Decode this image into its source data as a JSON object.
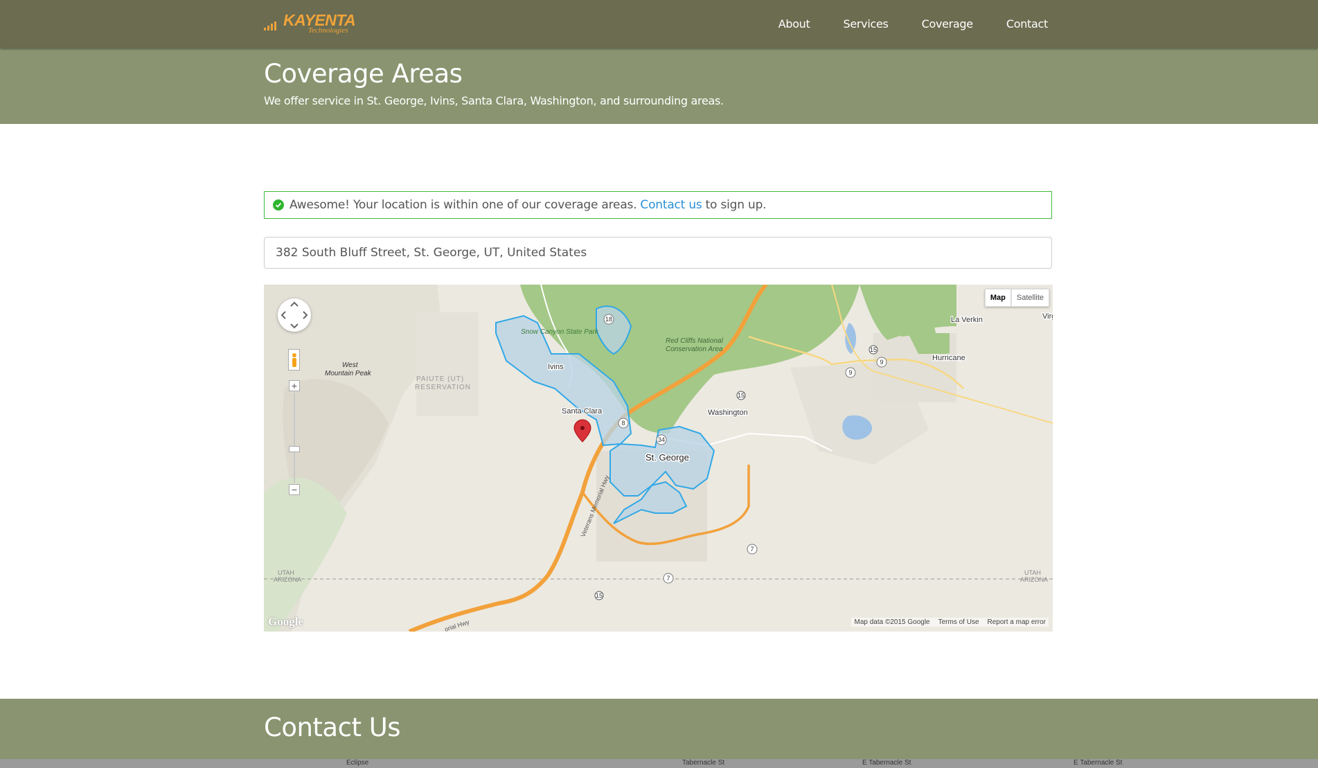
{
  "brand": {
    "name": "KAYENTA",
    "tagline": "Technologies"
  },
  "nav": {
    "items": [
      "About",
      "Services",
      "Coverage",
      "Contact"
    ]
  },
  "hero": {
    "title": "Coverage Areas",
    "subtitle": "We offer service in St. George, Ivins, Santa Clara, Washington, and surrounding areas."
  },
  "alert": {
    "pre": "Awesome! Your location is within one of our coverage areas.",
    "link": "Contact us",
    "post": "to sign up."
  },
  "search": {
    "value": "382 South Bluff Street, St. George, UT, United States"
  },
  "map": {
    "type_controls": {
      "map": "Map",
      "satellite": "Satellite",
      "selected": "Map"
    },
    "logo": "Google",
    "attribution": {
      "data": "Map data ©2015 Google",
      "terms": "Terms of Use",
      "report": "Report a map error"
    },
    "labels": {
      "st_george": "St. George",
      "ivins": "Ivins",
      "santa_clara": "Santa Clara",
      "washington": "Washington",
      "hurricane": "Hurricane",
      "la_verkin": "La Verkin",
      "virgin": "Virg",
      "snow_canyon": "Snow Canyon State Park",
      "red_cliffs_1": "Red Cliffs National",
      "red_cliffs_2": "Conservation Area",
      "west_mountain_1": "West",
      "west_mountain_2": "Mountain Peak",
      "paiute_1": "PAIUTE (UT)",
      "paiute_2": "RESERVATION",
      "utah_left": "UTAH",
      "arizona_left": "ARIZONA",
      "utah_right": "UTAH",
      "arizona_right": "ARIZONA",
      "veterans_hwy": "Veterans Memorial Hwy",
      "memorial_hwy": "orial Hwy"
    },
    "shields": [
      "15",
      "15",
      "15",
      "18",
      "8",
      "34",
      "9",
      "9",
      "7",
      "7"
    ],
    "colors": {
      "coverage_fill": "#b9d3e4",
      "coverage_stroke": "#31a8e6",
      "highway": "#f2a13b",
      "park": "#a4c887"
    }
  },
  "contact": {
    "title": "Contact Us"
  },
  "contact_map": {
    "streets": [
      "Eclipse",
      "Tabernacle St",
      "E Tabernacle St",
      "E Tabernacle St"
    ]
  },
  "colors": {
    "navbar": "#6b6c50",
    "hero": "#8a9470",
    "accent": "#f0a33a",
    "link": "#2a8fd6",
    "success": "#3dbb3d"
  }
}
